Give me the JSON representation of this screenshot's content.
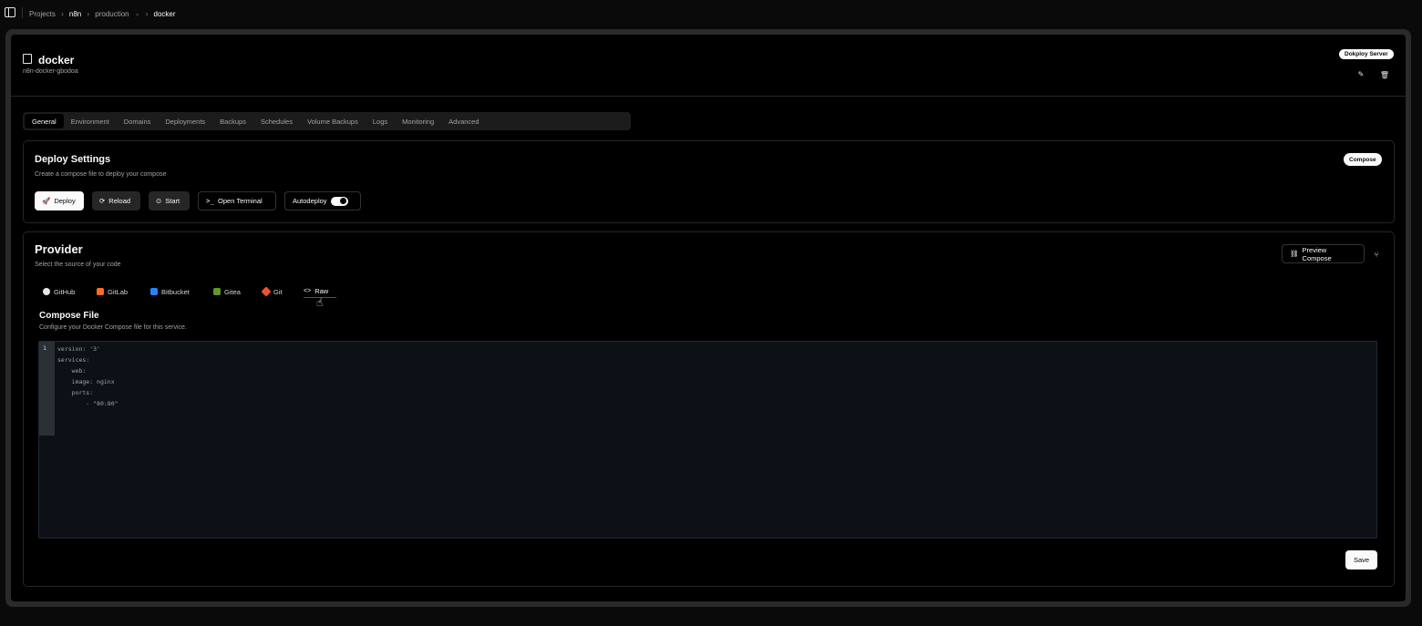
{
  "breadcrumb": {
    "items": [
      "Projects",
      "n8n",
      "production",
      "docker"
    ]
  },
  "app": {
    "title": "docker",
    "subtitle": "n8n-docker-gbodoa",
    "server_badge": "Dokploy Server"
  },
  "tabs": [
    "General",
    "Environment",
    "Domains",
    "Deployments",
    "Backups",
    "Schedules",
    "Volume Backups",
    "Logs",
    "Monitoring",
    "Advanced"
  ],
  "active_tab": "General",
  "deploy": {
    "title": "Deploy Settings",
    "description": "Create a compose file to deploy your compose",
    "badge": "Compose",
    "buttons": {
      "deploy": "Deploy",
      "reload": "Reload",
      "start": "Start",
      "terminal": "Open Terminal",
      "autodeploy": "Autodeploy"
    },
    "autodeploy_on": true
  },
  "provider": {
    "title": "Provider",
    "description": "Select the source of your code",
    "preview_button": "Preview Compose",
    "sources": [
      "GitHub",
      "GitLab",
      "Bitbucket",
      "Gitea",
      "Git",
      "Raw"
    ],
    "active_source": "Raw",
    "colors": {
      "gitlab": "#fc6d26",
      "bitbucket": "#2684ff",
      "gitea": "#609926",
      "git": "#f05032"
    }
  },
  "compose": {
    "title": "Compose File",
    "description": "Configure your Docker Compose file for this service.",
    "line_number": "1",
    "lines": [
      "version: '3'",
      "services:",
      "    web:",
      "    image: nginx",
      "    ports:",
      "        - \"80:80\""
    ],
    "save_button": "Save"
  }
}
